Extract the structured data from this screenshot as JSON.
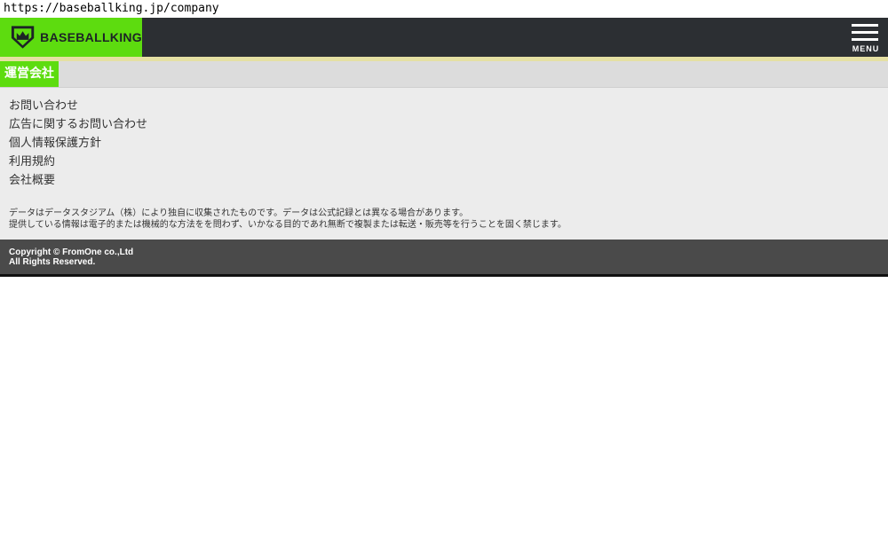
{
  "browser": {
    "url": "https://baseballking.jp/company"
  },
  "header": {
    "logo_text": "BASEBALLKING",
    "menu_label": "MENU",
    "colors": {
      "brand": "#5ddc0f",
      "header_bg": "#2c2f33",
      "accent_line": "#e5e0a3"
    }
  },
  "section": {
    "title": "運営会社"
  },
  "links": [
    {
      "label": "お問い合わせ"
    },
    {
      "label": "広告に関するお問い合わせ"
    },
    {
      "label": "個人情報保護方針"
    },
    {
      "label": "利用規約"
    },
    {
      "label": "会社概要"
    }
  ],
  "notes": {
    "line1": "データはデータスタジアム（株）により独自に収集されたものです。データは公式記録とは異なる場合があります。",
    "line2": "提供している情報は電子的または機械的な方法をを問わず、いかなる目的であれ無断で複製または転送・販売等を行うことを固く禁じます。"
  },
  "footer": {
    "copyright_line1": "Copyright © FromOne co.,Ltd",
    "copyright_line2": "All Rights Reserved."
  }
}
